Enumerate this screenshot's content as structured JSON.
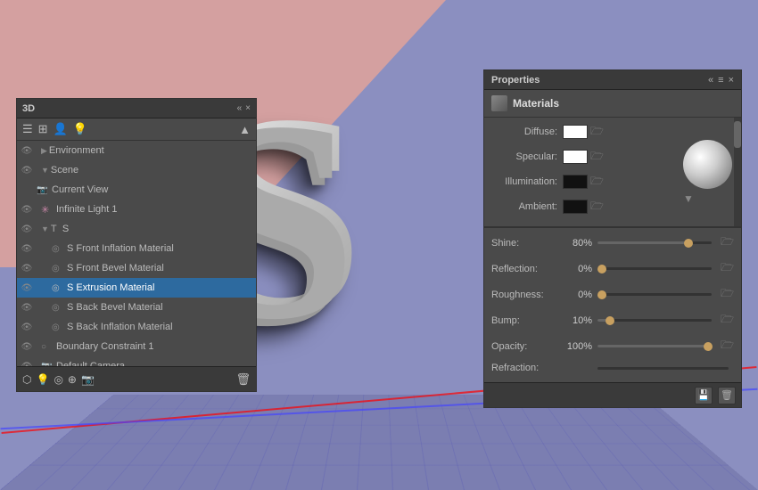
{
  "canvas": {
    "letter": "S"
  },
  "panel3d": {
    "title": "3D",
    "collapse_label": "«",
    "close_label": "×",
    "layers": [
      {
        "id": "environment",
        "label": "Environment",
        "indent": 10,
        "type": "env",
        "visible": true,
        "selected": false
      },
      {
        "id": "scene",
        "label": "Scene",
        "indent": 10,
        "type": "scene",
        "visible": true,
        "selected": false
      },
      {
        "id": "current-view",
        "label": "Current View",
        "indent": 20,
        "type": "camera",
        "visible": false,
        "selected": false
      },
      {
        "id": "infinite-light-1",
        "label": "Infinite Light 1",
        "indent": 20,
        "type": "light",
        "visible": true,
        "selected": false
      },
      {
        "id": "s",
        "label": "S",
        "indent": 20,
        "type": "object",
        "visible": true,
        "selected": false
      },
      {
        "id": "s-front-inflation",
        "label": "S Front Inflation Material",
        "indent": 30,
        "type": "material",
        "visible": true,
        "selected": false
      },
      {
        "id": "s-front-bevel",
        "label": "S Front Bevel Material",
        "indent": 30,
        "type": "material",
        "visible": true,
        "selected": false
      },
      {
        "id": "s-extrusion",
        "label": "S Extrusion Material",
        "indent": 30,
        "type": "material",
        "visible": true,
        "selected": true
      },
      {
        "id": "s-back-bevel",
        "label": "S Back Bevel Material",
        "indent": 30,
        "type": "material",
        "visible": true,
        "selected": false
      },
      {
        "id": "s-back-inflation",
        "label": "S Back Inflation Material",
        "indent": 30,
        "type": "material",
        "visible": true,
        "selected": false
      },
      {
        "id": "boundary-constraint-1",
        "label": "Boundary Constraint 1",
        "indent": 20,
        "type": "constraint",
        "visible": true,
        "selected": false
      },
      {
        "id": "default-camera",
        "label": "Default Camera",
        "indent": 20,
        "type": "camera",
        "visible": true,
        "selected": false
      }
    ],
    "toolbar_icons": [
      "list",
      "grid",
      "person",
      "light"
    ],
    "bottom_icons": [
      "mesh",
      "light",
      "material",
      "constraint",
      "camera",
      "delete"
    ]
  },
  "properties": {
    "title": "Properties",
    "collapse_label": "«",
    "close_label": "×",
    "menu_label": "≡",
    "section": "Materials",
    "fields": {
      "diffuse_label": "Diffuse:",
      "specular_label": "Specular:",
      "illumination_label": "Illumination:",
      "ambient_label": "Ambient:"
    },
    "sliders": [
      {
        "id": "shine",
        "label": "Shine:",
        "value": "80%",
        "percent": 80
      },
      {
        "id": "reflection",
        "label": "Reflection:",
        "value": "0%",
        "percent": 0
      },
      {
        "id": "roughness",
        "label": "Roughness:",
        "value": "0%",
        "percent": 0
      },
      {
        "id": "bump",
        "label": "Bump:",
        "value": "10%",
        "percent": 10
      },
      {
        "id": "opacity",
        "label": "Opacity:",
        "value": "100%",
        "percent": 100
      },
      {
        "id": "refraction",
        "label": "Refraction:",
        "value": "",
        "percent": 0
      }
    ]
  }
}
